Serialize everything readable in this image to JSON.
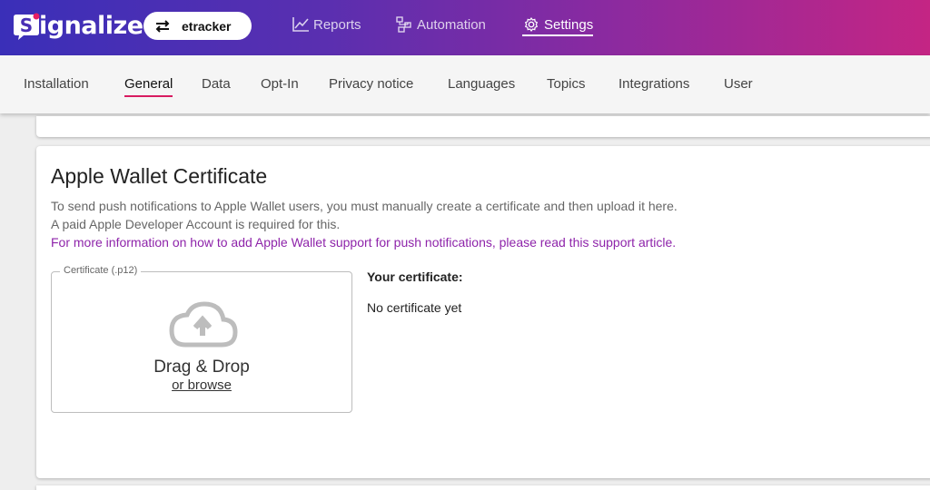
{
  "header": {
    "logo_text": "ignalize",
    "tenant": {
      "label": "etracker",
      "icon": "swap-arrows-icon"
    },
    "nav": [
      {
        "label": "Reports",
        "icon": "chart-line-icon"
      },
      {
        "label": "Automation",
        "icon": "flow-icon"
      },
      {
        "label": "Settings",
        "icon": "gear-icon",
        "active": true
      }
    ]
  },
  "tabs": [
    {
      "label": "Installation"
    },
    {
      "label": "General",
      "active": true
    },
    {
      "label": "Data"
    },
    {
      "label": "Opt-In"
    },
    {
      "label": "Privacy notice"
    },
    {
      "label": "Languages"
    },
    {
      "label": "Topics"
    },
    {
      "label": "Integrations"
    },
    {
      "label": "User"
    }
  ],
  "card": {
    "title": "Apple Wallet Certificate",
    "desc1": "To send push notifications to Apple Wallet users, you must manually create a certificate and then upload it here.",
    "desc2": "A paid Apple Developer Account is required for this.",
    "link": "For more information on how to add Apple Wallet support for push notifications, please read this support article.",
    "upload": {
      "legend": "Certificate (.p12)",
      "drag_label": "Drag & Drop",
      "browse_label": "or browse",
      "icon": "cloud-upload-icon"
    },
    "certificate_heading": "Your certificate:",
    "certificate_value": "No certificate yet"
  },
  "colors": {
    "header_start": "#3a2fb8",
    "header_end": "#c42584",
    "tab_underline": "#d81b60",
    "link": "#8e24aa"
  }
}
